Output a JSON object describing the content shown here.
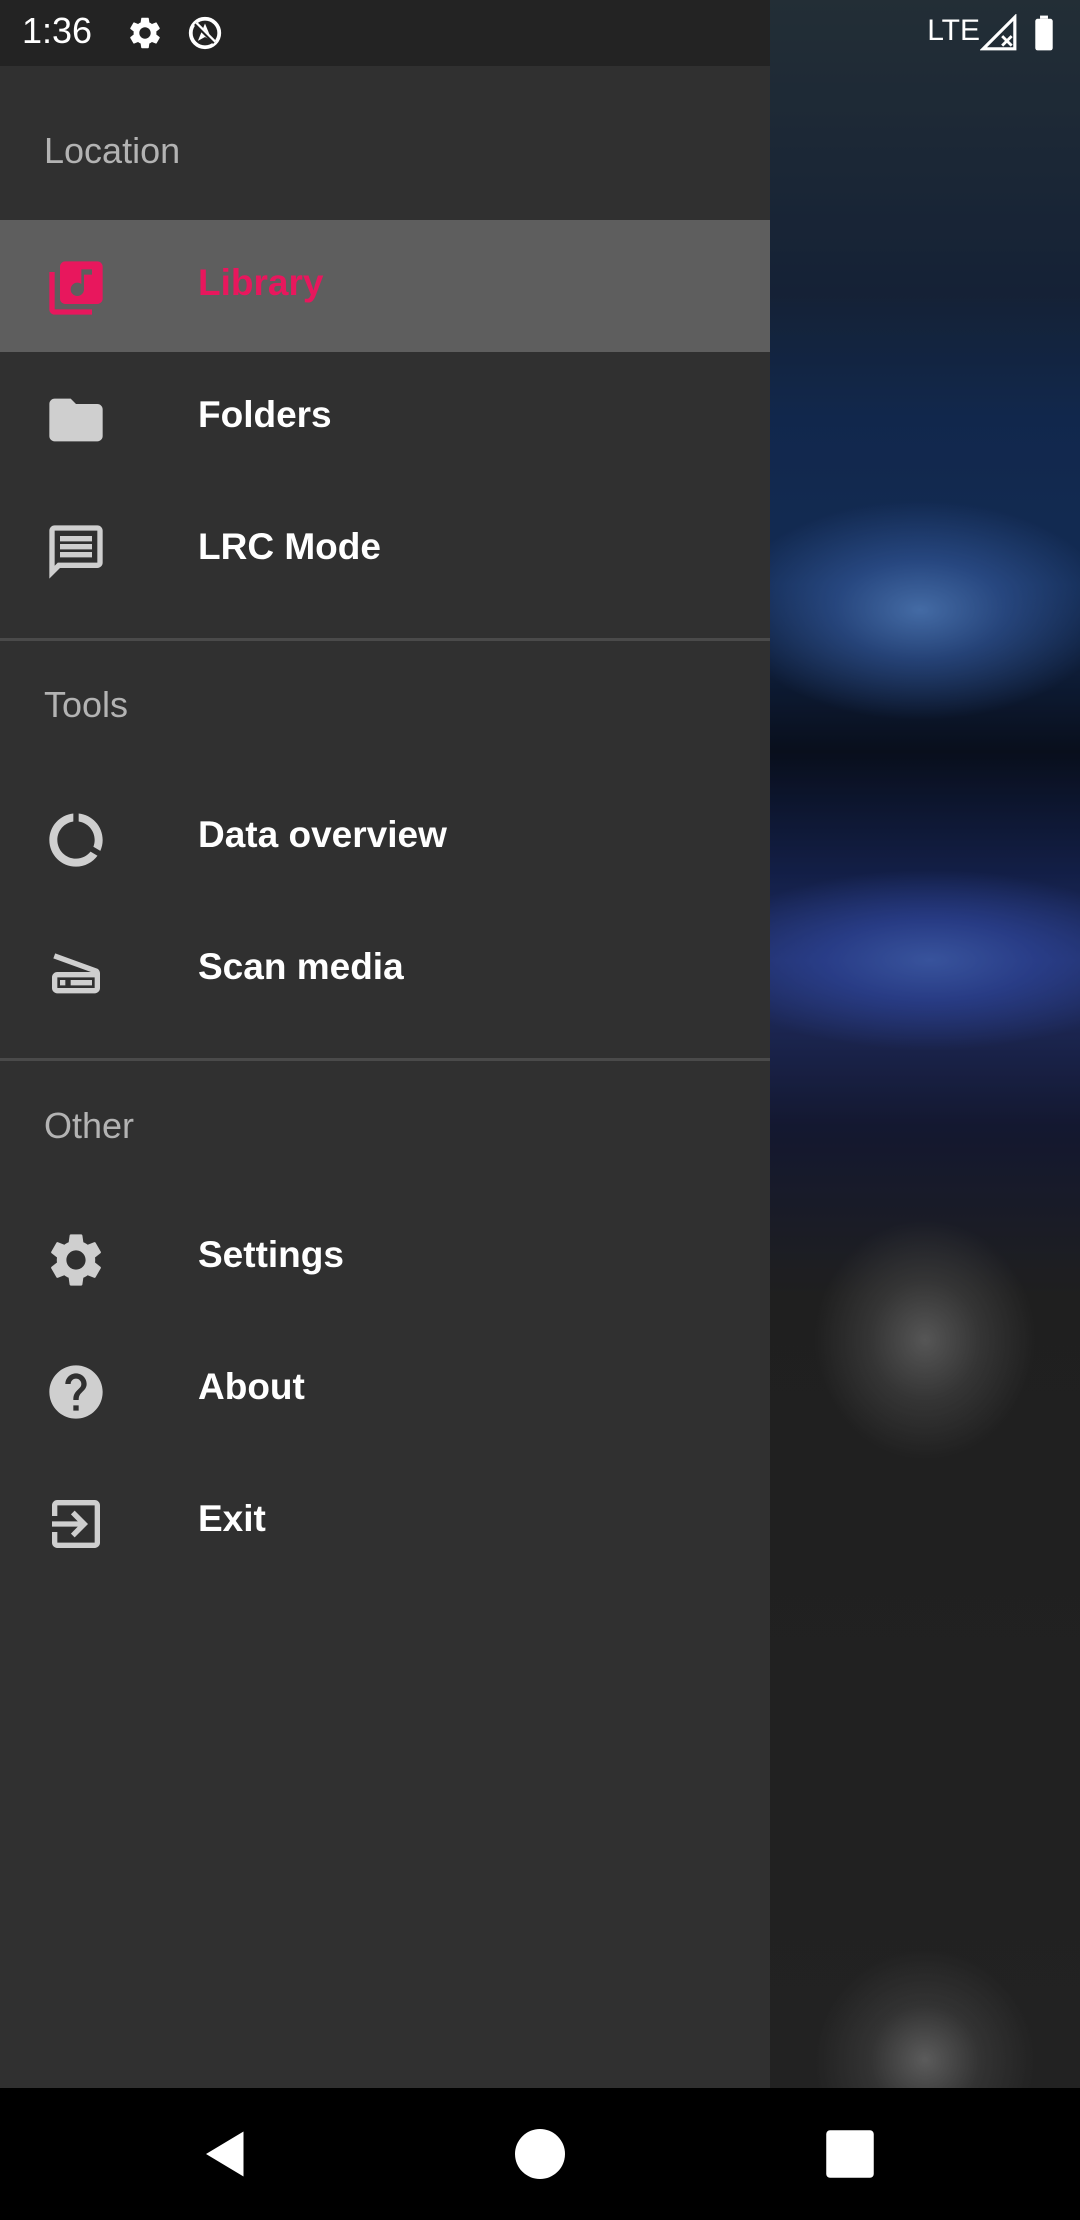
{
  "status_bar": {
    "time": "1:36",
    "network": "LTE",
    "icons": [
      "gear-icon",
      "location-off-icon",
      "signal-icon",
      "battery-icon"
    ]
  },
  "drawer": {
    "sections": [
      {
        "header": "Location",
        "items": [
          {
            "label": "Library",
            "icon": "library-music-icon",
            "selected": true
          },
          {
            "label": "Folders",
            "icon": "folder-icon",
            "selected": false
          },
          {
            "label": "LRC Mode",
            "icon": "lyrics-comment-icon",
            "selected": false
          }
        ]
      },
      {
        "header": "Tools",
        "items": [
          {
            "label": "Data overview",
            "icon": "donut-chart-icon",
            "selected": false
          },
          {
            "label": "Scan media",
            "icon": "scanner-icon",
            "selected": false
          }
        ]
      },
      {
        "header": "Other",
        "items": [
          {
            "label": "Settings",
            "icon": "gear-icon",
            "selected": false
          },
          {
            "label": "About",
            "icon": "help-icon",
            "selected": false
          },
          {
            "label": "Exit",
            "icon": "exit-icon",
            "selected": false
          }
        ]
      }
    ]
  },
  "colors": {
    "accent": "#e8175d",
    "drawer_bg": "#303030",
    "selected_bg": "#5e5e5e",
    "icon": "#cfcfcf"
  },
  "nav_bar": {
    "buttons": [
      "back-icon",
      "home-icon",
      "recents-icon"
    ]
  }
}
